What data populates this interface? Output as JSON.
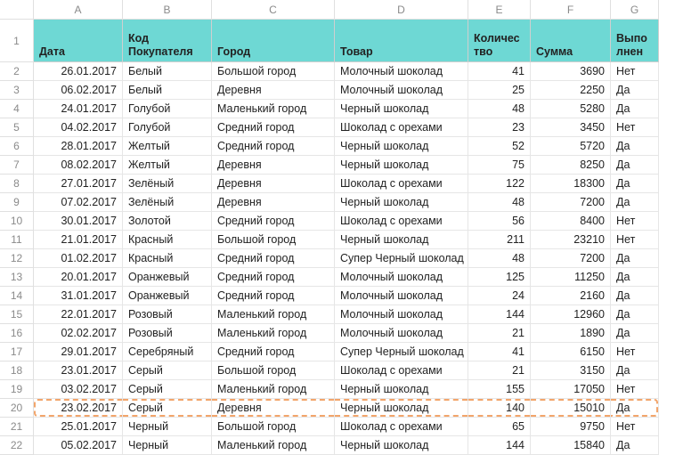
{
  "columns": [
    "A",
    "B",
    "C",
    "D",
    "E",
    "F",
    "G"
  ],
  "headers": {
    "A": "Дата",
    "B": "Код Покупателя",
    "C": "Город",
    "D": "Товар",
    "E": "Количество",
    "F": "Сумма",
    "G": "Выполнен"
  },
  "highlight_row": 20,
  "rows": [
    {
      "n": 2,
      "A": "26.01.2017",
      "B": "Белый",
      "C": "Большой город",
      "D": "Молочный шоколад",
      "E": 41,
      "F": 3690,
      "G": "Нет"
    },
    {
      "n": 3,
      "A": "06.02.2017",
      "B": "Белый",
      "C": "Деревня",
      "D": "Молочный шоколад",
      "E": 25,
      "F": 2250,
      "G": "Да"
    },
    {
      "n": 4,
      "A": "24.01.2017",
      "B": "Голубой",
      "C": "Маленький город",
      "D": "Черный шоколад",
      "E": 48,
      "F": 5280,
      "G": "Да"
    },
    {
      "n": 5,
      "A": "04.02.2017",
      "B": "Голубой",
      "C": "Средний город",
      "D": "Шоколад с орехами",
      "E": 23,
      "F": 3450,
      "G": "Нет"
    },
    {
      "n": 6,
      "A": "28.01.2017",
      "B": "Желтый",
      "C": "Средний город",
      "D": "Черный шоколад",
      "E": 52,
      "F": 5720,
      "G": "Да"
    },
    {
      "n": 7,
      "A": "08.02.2017",
      "B": "Желтый",
      "C": "Деревня",
      "D": "Черный шоколад",
      "E": 75,
      "F": 8250,
      "G": "Да"
    },
    {
      "n": 8,
      "A": "27.01.2017",
      "B": "Зелёный",
      "C": "Деревня",
      "D": "Шоколад с орехами",
      "E": 122,
      "F": 18300,
      "G": "Да"
    },
    {
      "n": 9,
      "A": "07.02.2017",
      "B": "Зелёный",
      "C": "Деревня",
      "D": "Черный шоколад",
      "E": 48,
      "F": 7200,
      "G": "Да"
    },
    {
      "n": 10,
      "A": "30.01.2017",
      "B": "Золотой",
      "C": "Средний город",
      "D": "Шоколад с орехами",
      "E": 56,
      "F": 8400,
      "G": "Нет"
    },
    {
      "n": 11,
      "A": "21.01.2017",
      "B": "Красный",
      "C": "Большой город",
      "D": "Черный шоколад",
      "E": 211,
      "F": 23210,
      "G": "Нет"
    },
    {
      "n": 12,
      "A": "01.02.2017",
      "B": "Красный",
      "C": "Средний город",
      "D": "Супер Черный шоколад",
      "E": 48,
      "F": 7200,
      "G": "Да"
    },
    {
      "n": 13,
      "A": "20.01.2017",
      "B": "Оранжевый",
      "C": "Средний город",
      "D": "Молочный шоколад",
      "E": 125,
      "F": 11250,
      "G": "Да"
    },
    {
      "n": 14,
      "A": "31.01.2017",
      "B": "Оранжевый",
      "C": "Средний город",
      "D": "Молочный шоколад",
      "E": 24,
      "F": 2160,
      "G": "Да"
    },
    {
      "n": 15,
      "A": "22.01.2017",
      "B": "Розовый",
      "C": "Маленький город",
      "D": "Молочный шоколад",
      "E": 144,
      "F": 12960,
      "G": "Да"
    },
    {
      "n": 16,
      "A": "02.02.2017",
      "B": "Розовый",
      "C": "Маленький город",
      "D": "Молочный шоколад",
      "E": 21,
      "F": 1890,
      "G": "Да"
    },
    {
      "n": 17,
      "A": "29.01.2017",
      "B": "Серебряный",
      "C": "Средний город",
      "D": "Супер Черный шоколад",
      "E": 41,
      "F": 6150,
      "G": "Нет"
    },
    {
      "n": 18,
      "A": "23.01.2017",
      "B": "Серый",
      "C": "Большой город",
      "D": "Шоколад с орехами",
      "E": 21,
      "F": 3150,
      "G": "Да"
    },
    {
      "n": 19,
      "A": "03.02.2017",
      "B": "Серый",
      "C": "Маленький город",
      "D": "Черный шоколад",
      "E": 155,
      "F": 17050,
      "G": "Нет"
    },
    {
      "n": 20,
      "A": "23.02.2017",
      "B": "Серый",
      "C": "Деревня",
      "D": "Черный шоколад",
      "E": 140,
      "F": 15010,
      "G": "Да"
    },
    {
      "n": 21,
      "A": "25.01.2017",
      "B": "Черный",
      "C": "Большой город",
      "D": "Шоколад с орехами",
      "E": 65,
      "F": 9750,
      "G": "Нет"
    },
    {
      "n": 22,
      "A": "05.02.2017",
      "B": "Черный",
      "C": "Маленький город",
      "D": "Черный шоколад",
      "E": 144,
      "F": 15840,
      "G": "Да"
    }
  ]
}
